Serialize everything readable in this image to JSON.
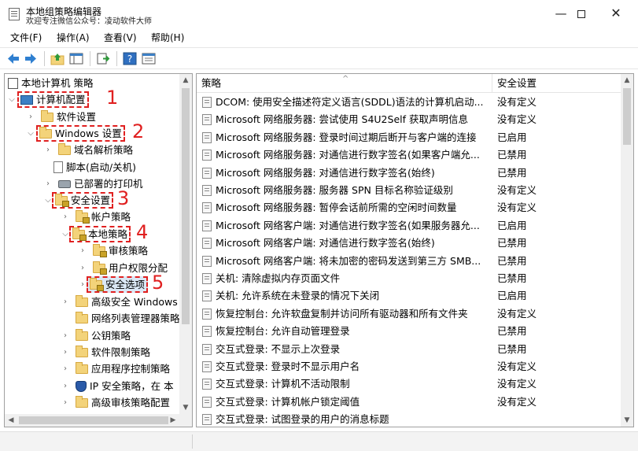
{
  "window": {
    "title": "本地组策略编辑器",
    "subtitle": "欢迎专注微信公众号：凌动软件大师",
    "minimize_glyph": "—",
    "close_glyph": "✕"
  },
  "menu": [
    "文件(F)",
    "操作(A)",
    "查看(V)",
    "帮助(H)"
  ],
  "toolbar_icons": [
    "back-arrow-icon",
    "forward-arrow-icon",
    "up-folder-icon",
    "show-hide-tree-icon",
    "export-list-icon",
    "help-icon",
    "properties-icon"
  ],
  "tree": {
    "root": "本地计算机 策略",
    "computer_config": "计算机配置",
    "software_settings": "软件设置",
    "windows_settings": "Windows 设置",
    "dns_policy": "域名解析策略",
    "scripts": "脚本(启动/关机)",
    "printers": "已部署的打印机",
    "security_settings": "安全设置",
    "account_policy": "帐户策略",
    "local_policy": "本地策略",
    "audit_policy": "审核策略",
    "user_rights": "用户权限分配",
    "security_options": "安全选项",
    "advanced_firewall": "高级安全 Windows",
    "network_list": "网络列表管理器策略",
    "public_key": "公钥策略",
    "software_restriction": "软件限制策略",
    "app_control": "应用程序控制策略",
    "ip_security": "IP 安全策略，在 本",
    "advanced_audit": "高级审核策略配置"
  },
  "annotations": [
    "1",
    "2",
    "3",
    "4",
    "5"
  ],
  "columns": {
    "policy": "策略",
    "setting": "安全设置"
  },
  "policies": [
    {
      "name": "DCOM: 使用安全描述符定义语言(SDDL)语法的计算机启动...",
      "setting": "没有定义"
    },
    {
      "name": "Microsoft 网络服务器: 尝试使用 S4U2Self 获取声明信息",
      "setting": "没有定义"
    },
    {
      "name": "Microsoft 网络服务器: 登录时间过期后断开与客户端的连接",
      "setting": "已启用"
    },
    {
      "name": "Microsoft 网络服务器: 对通信进行数字签名(如果客户端允...",
      "setting": "已禁用"
    },
    {
      "name": "Microsoft 网络服务器: 对通信进行数字签名(始终)",
      "setting": "已禁用"
    },
    {
      "name": "Microsoft 网络服务器: 服务器 SPN 目标名称验证级别",
      "setting": "没有定义"
    },
    {
      "name": "Microsoft 网络服务器: 暂停会话前所需的空闲时间数量",
      "setting": "没有定义"
    },
    {
      "name": "Microsoft 网络客户端: 对通信进行数字签名(如果服务器允...",
      "setting": "已启用"
    },
    {
      "name": "Microsoft 网络客户端: 对通信进行数字签名(始终)",
      "setting": "已禁用"
    },
    {
      "name": "Microsoft 网络客户端: 将未加密的密码发送到第三方 SMB...",
      "setting": "已禁用"
    },
    {
      "name": "关机: 清除虚拟内存页面文件",
      "setting": "已禁用"
    },
    {
      "name": "关机: 允许系统在未登录的情况下关闭",
      "setting": "已启用"
    },
    {
      "name": "恢复控制台: 允许软盘复制并访问所有驱动器和所有文件夹",
      "setting": "没有定义"
    },
    {
      "name": "恢复控制台: 允许自动管理登录",
      "setting": "已禁用"
    },
    {
      "name": "交互式登录: 不显示上次登录",
      "setting": "已禁用"
    },
    {
      "name": "交互式登录: 登录时不显示用户名",
      "setting": "没有定义"
    },
    {
      "name": "交互式登录: 计算机不活动限制",
      "setting": "没有定义"
    },
    {
      "name": "交互式登录: 计算机帐户锁定阈值",
      "setting": "没有定义"
    },
    {
      "name": "交互式登录: 试图登录的用户的消息标题",
      "setting": ""
    }
  ],
  "colors": {
    "annotation_red": "#e02020",
    "folder": "#f3d37a"
  }
}
